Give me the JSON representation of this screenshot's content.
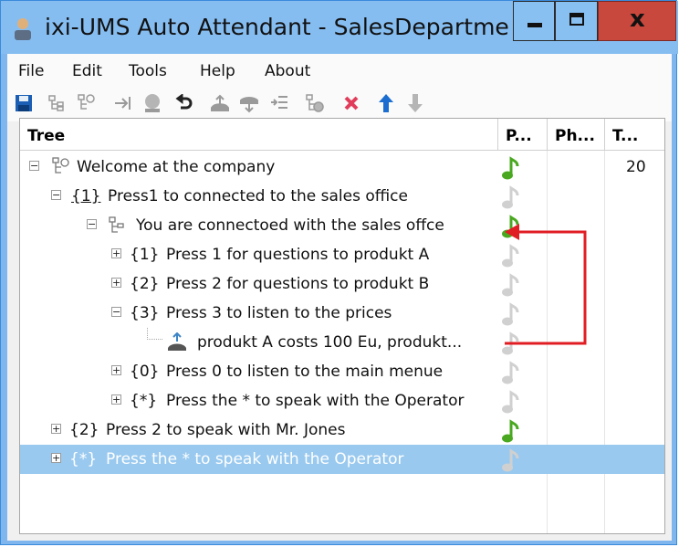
{
  "window": {
    "title": "ixi-UMS Auto Attendant - SalesDepartme...",
    "minimize_label": "minimize",
    "maximize_label": "maximize",
    "close_label": "x"
  },
  "menu": [
    "File",
    "Edit",
    "Tools",
    "Help",
    "About"
  ],
  "toolbar": [
    "save-icon",
    "tree-icon",
    "tree-add-icon",
    "forward-icon",
    "voice-icon",
    "undo-icon",
    "transfer-icon",
    "phone-icon",
    "insert-icon",
    "properties-icon",
    "delete-icon",
    "arrow-up-icon",
    "arrow-down-icon"
  ],
  "columns": {
    "tree": "Tree",
    "p": "P...",
    "ph": "Ph...",
    "t": "T..."
  },
  "rows": [
    {
      "key": "",
      "text": "Welcome at the company",
      "t": "20",
      "note": "green"
    },
    {
      "key": "{1}",
      "text": "Press1 to connected to the sales office",
      "t": "",
      "note": "gray"
    },
    {
      "key": "",
      "text": "You are connectoed with the sales offce",
      "t": "",
      "note": "green"
    },
    {
      "key": "{1}",
      "text": "Press 1 for questions to produkt A",
      "t": "",
      "note": "gray"
    },
    {
      "key": "{2}",
      "text": "Press 2 for questions to produkt B",
      "t": "",
      "note": "gray"
    },
    {
      "key": "{3}",
      "text": "Press 3 to listen to the prices",
      "t": "",
      "note": "gray"
    },
    {
      "key": "",
      "text": "produkt A costs 100 Eu, produkt...",
      "t": "",
      "note": "gray"
    },
    {
      "key": "{0}",
      "text": "Press 0 to listen to the main menue",
      "t": "",
      "note": "gray"
    },
    {
      "key": "{*}",
      "text": "Press the * to speak with the Operator",
      "t": "",
      "note": "gray"
    },
    {
      "key": "{2}",
      "text": "Press 2 to speak with Mr. Jones",
      "t": "",
      "note": "green"
    },
    {
      "key": "{*}",
      "text": "Press the * to speak with the Operator",
      "t": "",
      "note": "gray",
      "selected": true
    }
  ],
  "colors": {
    "note_green": "#4aa820",
    "note_gray": "#d0d0d0",
    "arrow_red": "#e11d24",
    "selection": "#99c9ef"
  }
}
